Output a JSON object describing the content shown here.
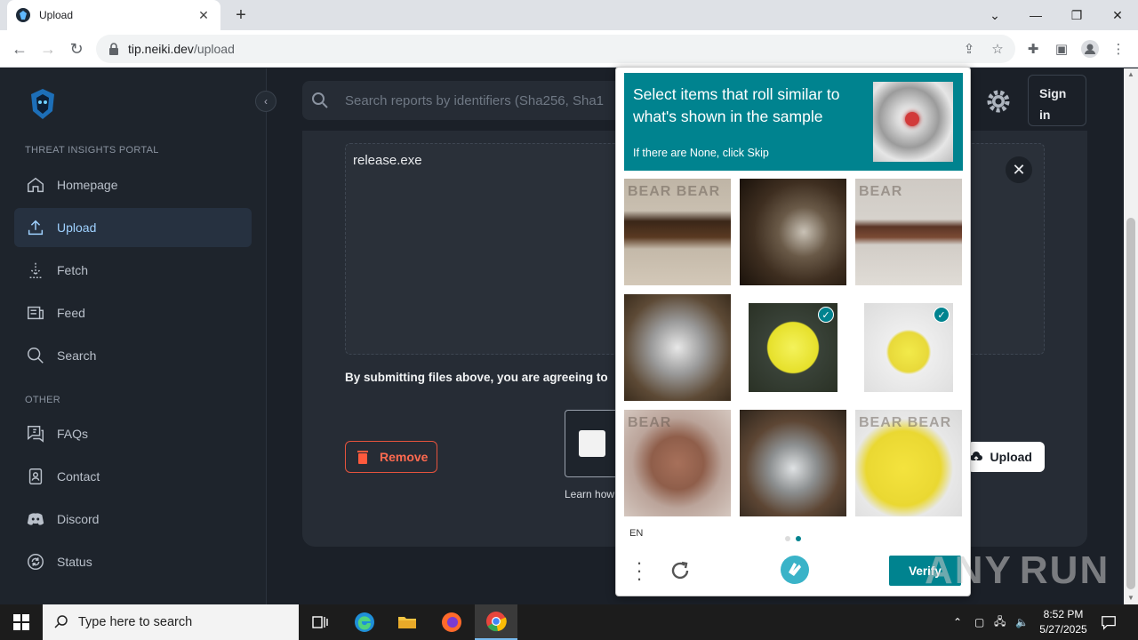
{
  "browser": {
    "tab_title": "Upload",
    "url_host": "tip.neiki.dev",
    "url_path": "/upload"
  },
  "sidebar": {
    "section_main": "THREAT INSIGHTS PORTAL",
    "section_other": "OTHER",
    "items": [
      {
        "label": "Homepage",
        "icon": "home-icon"
      },
      {
        "label": "Upload",
        "icon": "upload-icon",
        "active": true
      },
      {
        "label": "Fetch",
        "icon": "fetch-icon"
      },
      {
        "label": "Feed",
        "icon": "feed-icon"
      },
      {
        "label": "Search",
        "icon": "search-icon"
      }
    ],
    "other_items": [
      {
        "label": "FAQs",
        "icon": "faq-icon"
      },
      {
        "label": "Contact",
        "icon": "contact-icon"
      },
      {
        "label": "Discord",
        "icon": "discord-icon"
      },
      {
        "label": "Status",
        "icon": "status-icon"
      }
    ]
  },
  "header": {
    "search_placeholder": "Search reports by identifiers (Sha256, Sha1",
    "signin_label": "Sign in"
  },
  "upload": {
    "filename": "release.exe",
    "terms_text": "By submitting files above, you are agreeing to",
    "remove_label": "Remove",
    "learn_text": "Learn how",
    "upload_label": "Upload"
  },
  "captcha": {
    "title": "Select items that roll similar to what's shown in the sample",
    "subtitle": "If there are None, click Skip",
    "language": "EN",
    "verify_label": "Verify",
    "accent": "#00838f",
    "tiles": [
      {
        "name": "belt",
        "selected": false
      },
      {
        "name": "microscope-dark",
        "selected": false
      },
      {
        "name": "belt-grey",
        "selected": false
      },
      {
        "name": "microscope-grey",
        "selected": false
      },
      {
        "name": "tennis-ball-dark",
        "selected": true
      },
      {
        "name": "tennis-ball-light",
        "selected": true
      },
      {
        "name": "hat",
        "selected": false
      },
      {
        "name": "microscope-shelf",
        "selected": false
      },
      {
        "name": "tennis-ball-big",
        "selected": false
      }
    ]
  },
  "watermark": {
    "left": "ANY",
    "right": "RUN"
  },
  "taskbar": {
    "search_placeholder": "Type here to search",
    "time": "8:52 PM",
    "date": "5/27/2025"
  }
}
